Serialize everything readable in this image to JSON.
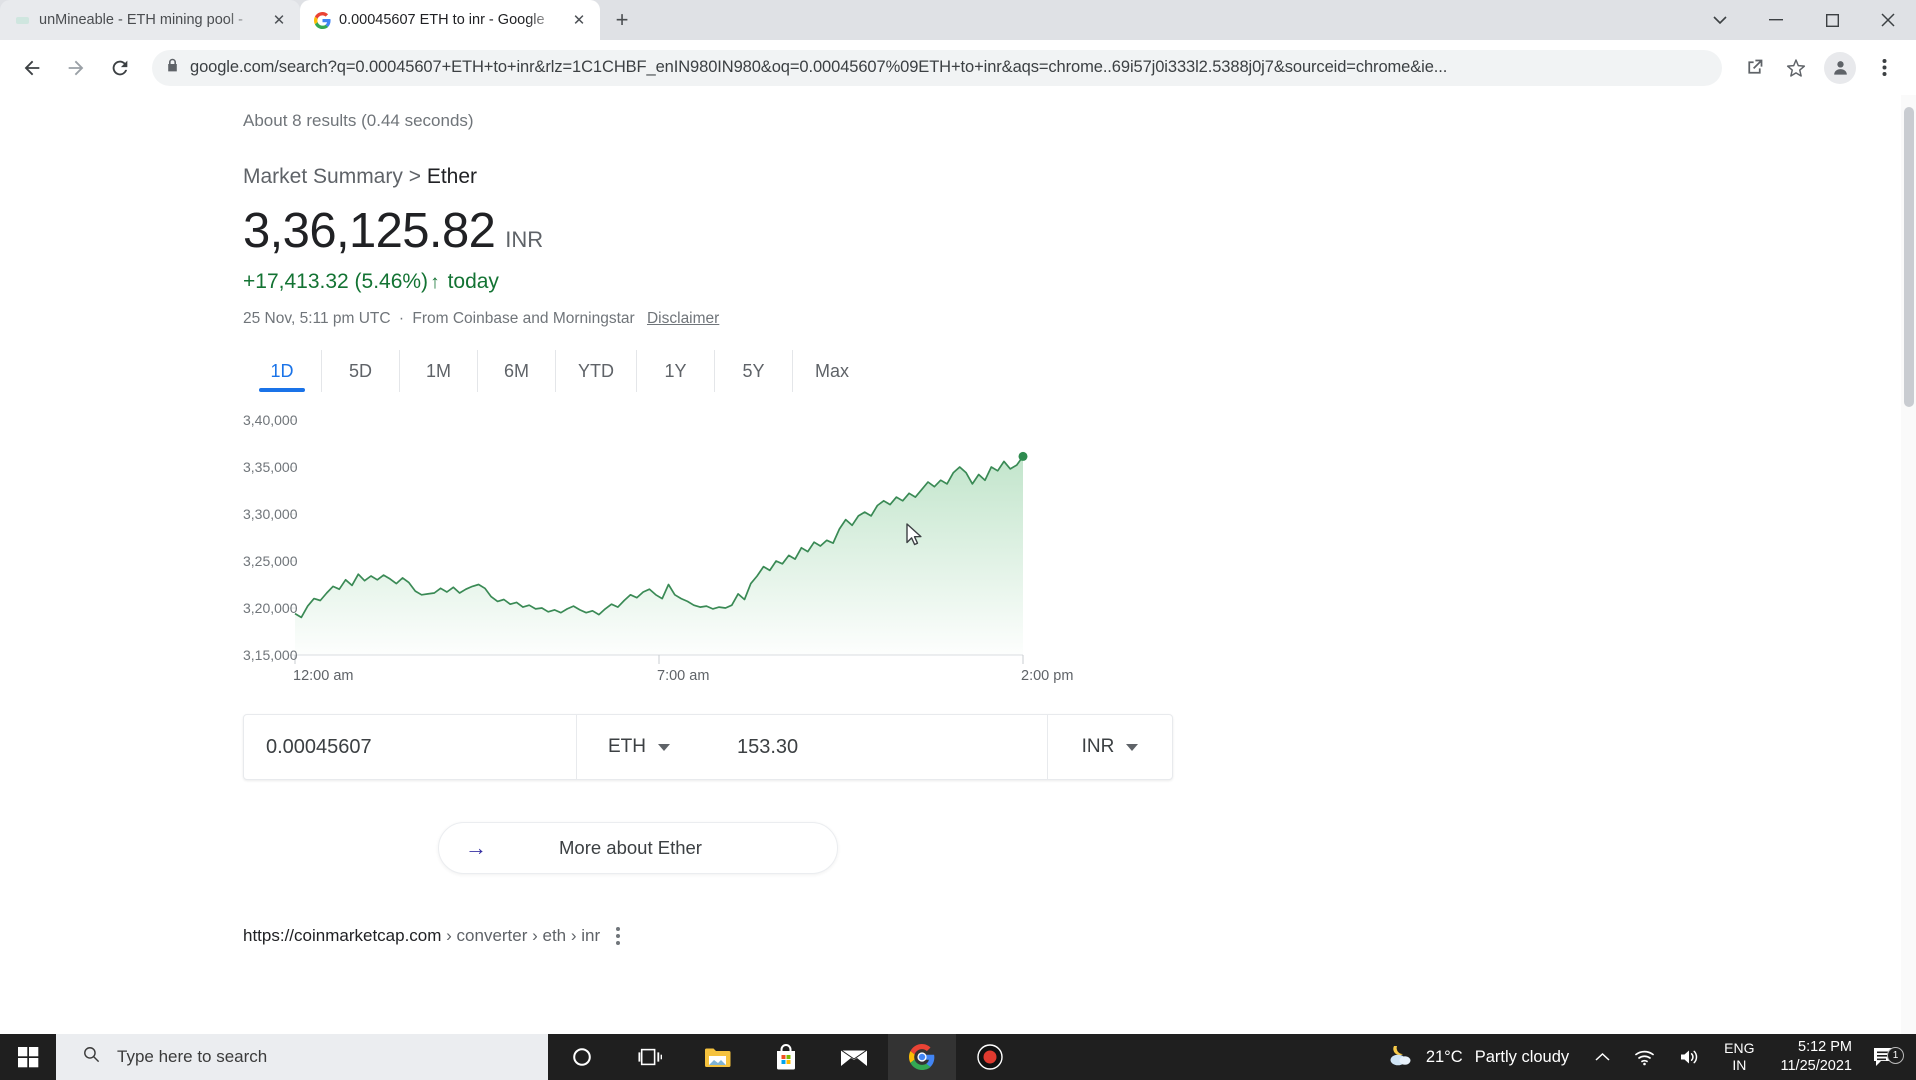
{
  "browser": {
    "tabs": [
      {
        "title": "unMineable - ETH mining pool -",
        "favicon": "generic-favicon",
        "active": false
      },
      {
        "title": "0.00045607 ETH to inr - Google",
        "favicon": "google-favicon",
        "active": true
      }
    ],
    "new_tab_label": "+",
    "window_controls": {
      "minimize": "–",
      "maximize": "☐",
      "close": "✕",
      "expand": "⌄"
    },
    "nav": {
      "back": "back-arrow",
      "forward": "forward-arrow",
      "reload": "reload-icon"
    },
    "omnibox": {
      "url": "google.com/search?q=0.00045607+ETH+to+inr&rlz=1C1CHBF_enIN980IN980&oq=0.00045607%09ETH+to+inr&aqs=chrome..69i57j0i333l2.5388j0j7&sourceid=chrome&ie...",
      "lock": "lock-icon"
    },
    "toolbar_right": {
      "share": "share-icon",
      "bookmark": "star-icon",
      "profile": "profile-avatar-icon",
      "menu": "kebab-menu-icon"
    }
  },
  "search": {
    "results_count": "About 8 results (0.44 seconds)"
  },
  "market": {
    "breadcrumb_root": "Market Summary",
    "breadcrumb_sep": ">",
    "breadcrumb_leaf": "Ether",
    "price": "3,36,125.82",
    "currency": "INR",
    "change_value": "+17,413.32 (5.46%)",
    "change_arrow": "↑",
    "change_period": "today",
    "timestamp": "25 Nov, 5:11 pm UTC",
    "source": "From Coinbase and Morningstar",
    "disclaimer": "Disclaimer",
    "accent_color": "#137333",
    "tab_active_color": "#1a73e8",
    "ranges": [
      {
        "label": "1D",
        "active": true
      },
      {
        "label": "5D",
        "active": false
      },
      {
        "label": "1M",
        "active": false
      },
      {
        "label": "6M",
        "active": false
      },
      {
        "label": "YTD",
        "active": false
      },
      {
        "label": "1Y",
        "active": false
      },
      {
        "label": "5Y",
        "active": false
      },
      {
        "label": "Max",
        "active": false
      }
    ]
  },
  "chart_data": {
    "type": "line",
    "title": "Ether price (ETH/INR) — 1 Day",
    "xlabel": "",
    "ylabel": "INR",
    "ytick_labels": [
      "3,40,000",
      "3,35,000",
      "3,30,000",
      "3,25,000",
      "3,20,000",
      "3,15,000"
    ],
    "ytick_values": [
      340000,
      335000,
      330000,
      325000,
      320000,
      315000
    ],
    "ylim": [
      315000,
      340000
    ],
    "xtick_labels": [
      "12:00 am",
      "7:00 am",
      "2:00 pm"
    ],
    "xtick_positions": [
      0,
      0.5,
      1.0
    ],
    "grid": false,
    "legend": "none",
    "line_color": "#34a853",
    "fill_color": "#34a853",
    "last_point_marker": true,
    "series": [
      {
        "name": "ETH/INR",
        "values": [
          319400,
          319000,
          320200,
          321000,
          320800,
          321600,
          322300,
          322000,
          323000,
          322400,
          323600,
          322900,
          323400,
          323000,
          323500,
          323100,
          322600,
          323200,
          322700,
          321800,
          321400,
          321500,
          321600,
          322100,
          321700,
          322200,
          321600,
          322000,
          322300,
          322500,
          322100,
          321200,
          320700,
          320900,
          320400,
          320600,
          320100,
          320300,
          319900,
          320000,
          319600,
          319800,
          319500,
          319900,
          320200,
          319800,
          319500,
          319700,
          319300,
          319900,
          320400,
          320100,
          320800,
          321400,
          321100,
          321700,
          322000,
          321400,
          321000,
          322500,
          321400,
          321000,
          320700,
          320300,
          320100,
          320200,
          319900,
          320100,
          320000,
          320300,
          321500,
          320900,
          322600,
          323400,
          324400,
          324000,
          325000,
          324700,
          325600,
          325200,
          326400,
          326000,
          327000,
          326600,
          327200,
          326900,
          328400,
          329400,
          328800,
          329800,
          330200,
          329800,
          330900,
          331400,
          331000,
          331800,
          331400,
          332200,
          331800,
          332600,
          333400,
          332900,
          333600,
          333200,
          334400,
          335000,
          334400,
          333200,
          334200,
          333600,
          335000,
          334600,
          335600,
          334800,
          335200,
          336126
        ]
      }
    ]
  },
  "converter": {
    "amount_from": "0.00045607",
    "currency_from": "ETH",
    "amount_to": "153.30",
    "currency_to": "INR",
    "caret": "chevron-down-icon"
  },
  "more_about": {
    "arrow": "→",
    "label": "More about Ether"
  },
  "result": {
    "url_host": "https://coinmarketcap.com",
    "url_path": " › converter › eth › inr",
    "kebab": "result-options-icon"
  },
  "taskbar": {
    "start": "windows-start-icon",
    "search_placeholder": "Type here to search",
    "search_icon": "search-icon",
    "apps": [
      {
        "name": "cortana-icon",
        "active": false
      },
      {
        "name": "task-view-icon",
        "active": false
      },
      {
        "name": "file-explorer-icon",
        "active": false
      },
      {
        "name": "microsoft-store-icon",
        "active": false
      },
      {
        "name": "mail-icon",
        "active": false
      },
      {
        "name": "chrome-icon",
        "active": true
      },
      {
        "name": "screen-recorder-icon",
        "active": false
      }
    ],
    "tray": {
      "weather_icon": "partly-cloudy-night-icon",
      "temperature": "21°C",
      "condition": "Partly cloudy",
      "chevron": "show-hidden-icons-icon",
      "network": "wifi-icon",
      "volume": "speaker-icon",
      "lang_line1": "ENG",
      "lang_line2": "IN",
      "time": "5:12 PM",
      "date": "11/25/2021",
      "notification_icon": "action-center-icon",
      "notification_count": "1"
    }
  }
}
